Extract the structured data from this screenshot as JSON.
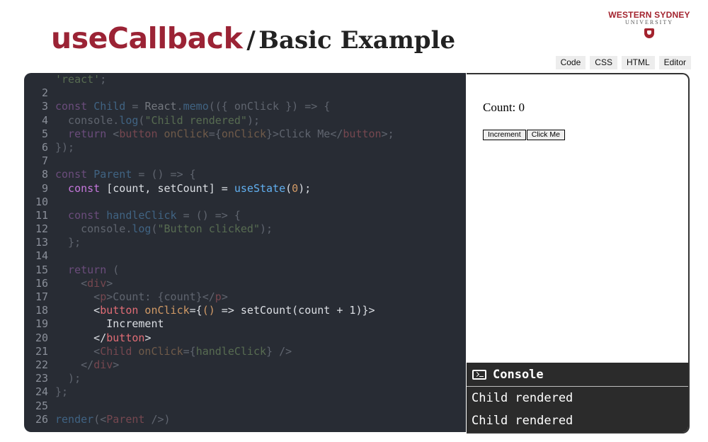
{
  "title": {
    "main": "useCallback",
    "separator": "/",
    "sub": "Basic Example"
  },
  "logo": {
    "line1": "WESTERN SYDNEY",
    "line2": "UNIVERSITY",
    "crest": "university-crest"
  },
  "tabs": [
    "Code",
    "CSS",
    "HTML",
    "Editor"
  ],
  "editor": {
    "lines": [
      [
        {
          "t": "'react'",
          "c": "t-str"
        },
        {
          "t": ";",
          "c": "t-plain"
        }
      ],
      [],
      [
        {
          "t": "const ",
          "c": "t-kw"
        },
        {
          "t": "Child",
          "c": "t-fn"
        },
        {
          "t": " = ",
          "c": "t-plain"
        },
        {
          "t": "React",
          "c": "t-bright"
        },
        {
          "t": ".",
          "c": "t-plain"
        },
        {
          "t": "memo",
          "c": "t-fn"
        },
        {
          "t": "(({ onClick }) => {",
          "c": "t-plain"
        }
      ],
      [
        {
          "t": "  console.",
          "c": "t-plain"
        },
        {
          "t": "log",
          "c": "t-fn"
        },
        {
          "t": "(",
          "c": "t-plain"
        },
        {
          "t": "\"Child rendered\"",
          "c": "t-str"
        },
        {
          "t": ");",
          "c": "t-plain"
        }
      ],
      [
        {
          "t": "  return ",
          "c": "t-kw"
        },
        {
          "t": "<",
          "c": "t-plain"
        },
        {
          "t": "button",
          "c": "t-tag"
        },
        {
          "t": " onClick",
          "c": "t-num"
        },
        {
          "t": "={",
          "c": "t-plain"
        },
        {
          "t": "onClick",
          "c": "t-num"
        },
        {
          "t": "}>Click Me</",
          "c": "t-plain"
        },
        {
          "t": "button",
          "c": "t-tag"
        },
        {
          "t": ">;",
          "c": "t-plain"
        }
      ],
      [
        {
          "t": "});",
          "c": "t-plain"
        }
      ],
      [],
      [
        {
          "t": "const ",
          "c": "t-kw"
        },
        {
          "t": "Parent",
          "c": "t-fn"
        },
        {
          "t": " = () => {",
          "c": "t-plain"
        }
      ],
      [
        {
          "t": "  const ",
          "c": "t-kw",
          "hl": true
        },
        {
          "t": "[count, setCount] = ",
          "c": "t-bright",
          "hl": true
        },
        {
          "t": "useState",
          "c": "t-fn",
          "hl": true
        },
        {
          "t": "(",
          "c": "t-bright",
          "hl": true
        },
        {
          "t": "0",
          "c": "t-num",
          "hl": true
        },
        {
          "t": ");",
          "c": "t-bright",
          "hl": true
        }
      ],
      [],
      [
        {
          "t": "  const ",
          "c": "t-kw"
        },
        {
          "t": "handleClick",
          "c": "t-fn"
        },
        {
          "t": " = () => {",
          "c": "t-plain"
        }
      ],
      [
        {
          "t": "    console.",
          "c": "t-plain"
        },
        {
          "t": "log",
          "c": "t-fn"
        },
        {
          "t": "(",
          "c": "t-plain"
        },
        {
          "t": "\"Button clicked\"",
          "c": "t-str"
        },
        {
          "t": ");",
          "c": "t-plain"
        }
      ],
      [
        {
          "t": "  };",
          "c": "t-plain"
        }
      ],
      [],
      [
        {
          "t": "  return ",
          "c": "t-kw"
        },
        {
          "t": "(",
          "c": "t-plain"
        }
      ],
      [
        {
          "t": "    <",
          "c": "t-plain"
        },
        {
          "t": "div",
          "c": "t-tag"
        },
        {
          "t": ">",
          "c": "t-plain"
        }
      ],
      [
        {
          "t": "      <",
          "c": "t-plain"
        },
        {
          "t": "p",
          "c": "t-tag"
        },
        {
          "t": ">Count: {count}</",
          "c": "t-plain"
        },
        {
          "t": "p",
          "c": "t-tag"
        },
        {
          "t": ">",
          "c": "t-plain"
        }
      ],
      [
        {
          "t": "      <",
          "c": "t-bright",
          "hl": true
        },
        {
          "t": "button",
          "c": "t-tag",
          "hl": true
        },
        {
          "t": " onClick",
          "c": "t-num",
          "hl": true
        },
        {
          "t": "={",
          "c": "t-bright",
          "hl": true
        },
        {
          "t": "()",
          "c": "t-num",
          "hl": true
        },
        {
          "t": " => setCount(count + 1)}>",
          "c": "t-bright",
          "hl": true
        }
      ],
      [
        {
          "t": "        Increment",
          "c": "t-bright",
          "hl": true
        }
      ],
      [
        {
          "t": "      </",
          "c": "t-bright",
          "hl": true
        },
        {
          "t": "button",
          "c": "t-tag",
          "hl": true
        },
        {
          "t": ">",
          "c": "t-bright",
          "hl": true
        }
      ],
      [
        {
          "t": "      <",
          "c": "t-plain"
        },
        {
          "t": "Child",
          "c": "t-tag"
        },
        {
          "t": " onClick",
          "c": "t-num"
        },
        {
          "t": "={",
          "c": "t-plain"
        },
        {
          "t": "handleClick",
          "c": "t-str"
        },
        {
          "t": "} />",
          "c": "t-plain"
        }
      ],
      [
        {
          "t": "    </",
          "c": "t-plain"
        },
        {
          "t": "div",
          "c": "t-tag"
        },
        {
          "t": ">",
          "c": "t-plain"
        }
      ],
      [
        {
          "t": "  );",
          "c": "t-plain"
        }
      ],
      [
        {
          "t": "};",
          "c": "t-plain"
        }
      ],
      [],
      [
        {
          "t": "render",
          "c": "t-fn"
        },
        {
          "t": "(<",
          "c": "t-plain"
        },
        {
          "t": "Parent",
          "c": "t-tag"
        },
        {
          "t": " />)",
          "c": "t-plain"
        }
      ]
    ],
    "line_numbers": [
      "",
      "2",
      "3",
      "4",
      "5",
      "6",
      "7",
      "8",
      "9",
      "10",
      "11",
      "12",
      "13",
      "14",
      "15",
      "16",
      "17",
      "18",
      "19",
      "20",
      "21",
      "22",
      "23",
      "24",
      "25",
      "26"
    ]
  },
  "preview": {
    "count_text": "Count: 0",
    "buttons": [
      "Increment",
      "Click Me"
    ]
  },
  "console": {
    "title": "Console",
    "icon": "terminal-icon",
    "logs": [
      "Child rendered",
      "Child rendered"
    ]
  }
}
